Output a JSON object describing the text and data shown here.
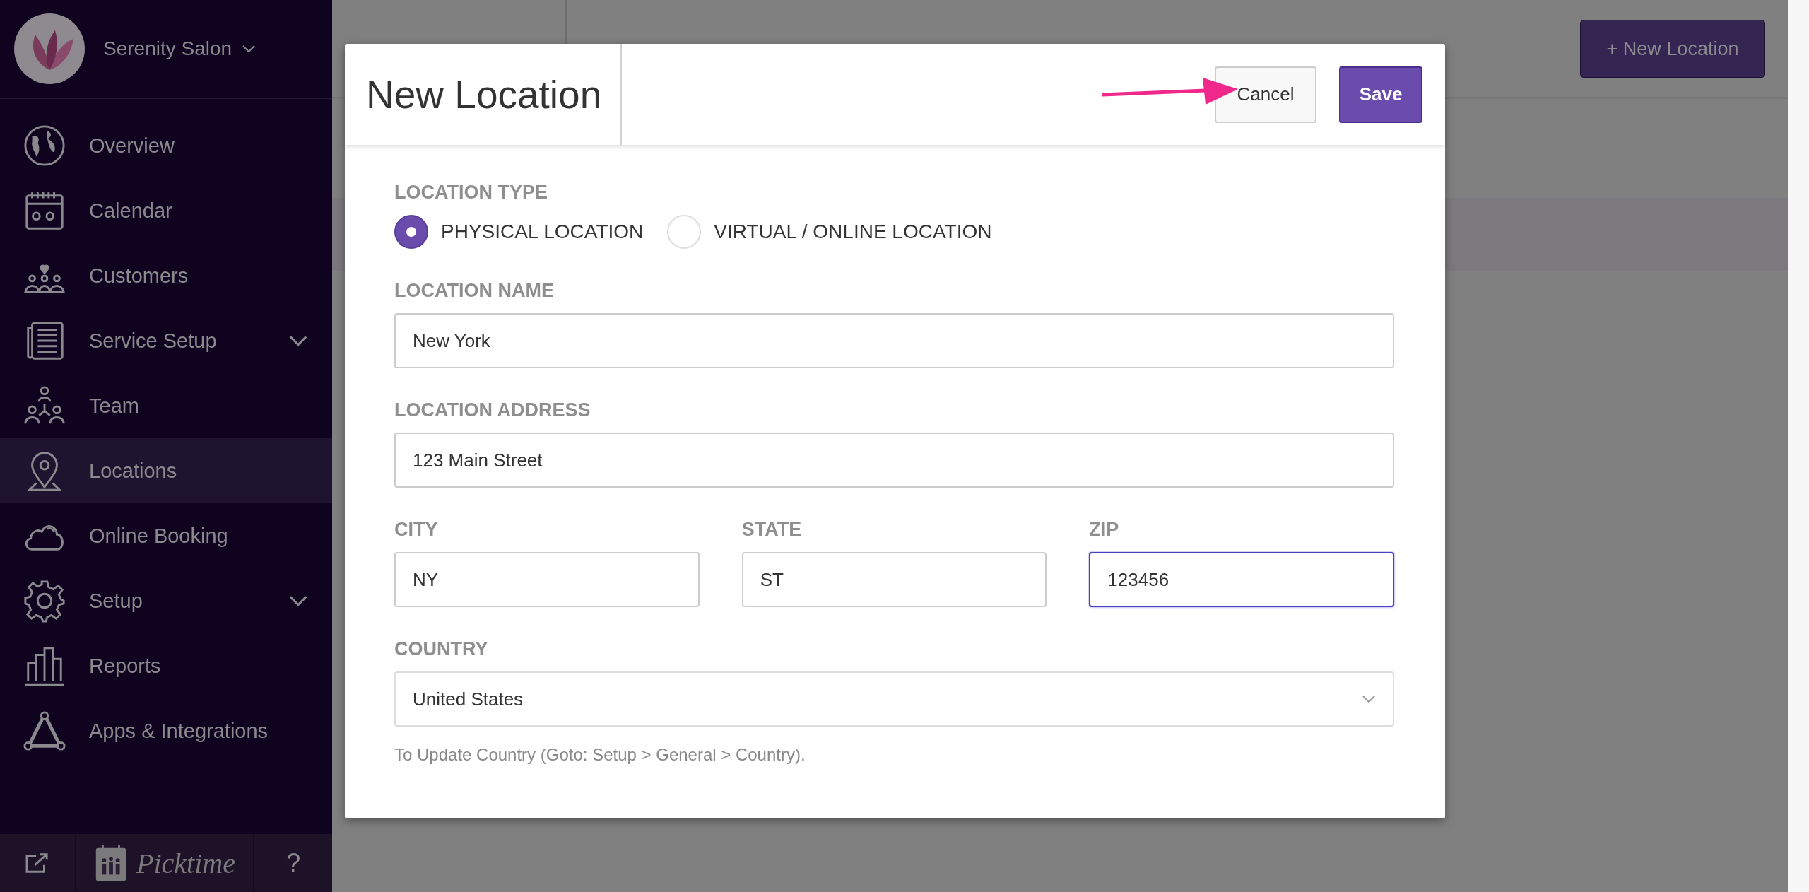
{
  "sidebar": {
    "account": {
      "name": "Serenity Salon"
    },
    "items": [
      {
        "label": "Overview",
        "selected": false
      },
      {
        "label": "Calendar",
        "selected": false
      },
      {
        "label": "Customers",
        "selected": false
      },
      {
        "label": "Service Setup",
        "selected": false,
        "expanded": false
      },
      {
        "label": "Team",
        "selected": false
      },
      {
        "label": "Locations",
        "selected": true
      },
      {
        "label": "Online Booking",
        "selected": false
      },
      {
        "label": "Setup",
        "selected": false,
        "expanded": false
      },
      {
        "label": "Reports",
        "selected": false
      },
      {
        "label": "Apps & Integrations",
        "selected": false
      }
    ],
    "footer": {
      "logo_text": "Picktime",
      "help": "?"
    }
  },
  "page": {
    "new_button": "+ New Location"
  },
  "modal": {
    "title": "New Location",
    "cancel": "Cancel",
    "save": "Save",
    "location_type": {
      "label": "LOCATION TYPE",
      "options": [
        {
          "label": "PHYSICAL LOCATION",
          "selected": true
        },
        {
          "label": "VIRTUAL / ONLINE LOCATION",
          "selected": false
        }
      ]
    },
    "fields": [
      {
        "label": "LOCATION NAME",
        "value": "New York",
        "focused": false
      },
      {
        "label": "LOCATION ADDRESS",
        "value": "123 Main Street",
        "focused": false
      }
    ],
    "address_row": [
      {
        "label": "CITY",
        "value": "NY",
        "focused": false
      },
      {
        "label": "STATE",
        "value": "ST",
        "focused": false
      },
      {
        "label": "ZIP",
        "value": "123456",
        "focused": true
      }
    ],
    "country": {
      "label": "COUNTRY",
      "value": "United States"
    },
    "hint": "To Update Country (Goto: Setup > General > Country)."
  }
}
